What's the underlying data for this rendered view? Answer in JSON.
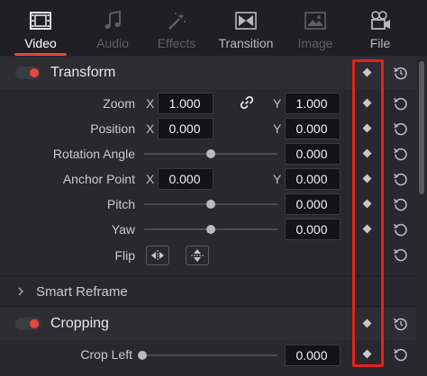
{
  "tabs": [
    {
      "label": "Video",
      "icon": "film-strip-icon",
      "state": "active"
    },
    {
      "label": "Audio",
      "icon": "music-note-icon",
      "state": "disabled"
    },
    {
      "label": "Effects",
      "icon": "magic-wand-icon",
      "state": "disabled"
    },
    {
      "label": "Transition",
      "icon": "transition-icon",
      "state": "partial"
    },
    {
      "label": "Image",
      "icon": "image-icon",
      "state": "disabled"
    },
    {
      "label": "File",
      "icon": "film-camera-icon",
      "state": "partial"
    }
  ],
  "transform": {
    "title": "Transform",
    "enabled": true,
    "zoom": {
      "label": "Zoom",
      "x_axis": "X",
      "x": "1.000",
      "y_axis": "Y",
      "y": "1.000"
    },
    "position": {
      "label": "Position",
      "x_axis": "X",
      "x": "0.000",
      "y_axis": "Y",
      "y": "0.000"
    },
    "rotation": {
      "label": "Rotation Angle",
      "value": "0.000"
    },
    "anchor": {
      "label": "Anchor Point",
      "x_axis": "X",
      "x": "0.000",
      "y_axis": "Y",
      "y": "0.000"
    },
    "pitch": {
      "label": "Pitch",
      "value": "0.000"
    },
    "yaw": {
      "label": "Yaw",
      "value": "0.000"
    },
    "flip": {
      "label": "Flip"
    }
  },
  "smart_reframe": {
    "title": "Smart Reframe"
  },
  "cropping": {
    "title": "Cropping",
    "enabled": true,
    "crop_left": {
      "label": "Crop Left",
      "value": "0.000"
    }
  },
  "colors": {
    "accent": "#e0483f",
    "highlight_box": "#e2231a",
    "panel": "#28282e",
    "field": "#141418"
  }
}
